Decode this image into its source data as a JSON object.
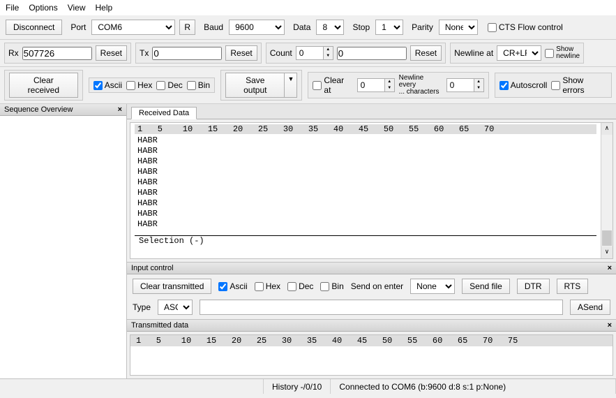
{
  "menu": {
    "file": "File",
    "options": "Options",
    "view": "View",
    "help": "Help"
  },
  "toolbar": {
    "disconnect": "Disconnect",
    "port_label": "Port",
    "port_value": "COM6",
    "r_button": "R",
    "baud_label": "Baud",
    "baud_value": "9600",
    "data_label": "Data",
    "data_value": "8",
    "stop_label": "Stop",
    "stop_value": "1",
    "parity_label": "Parity",
    "parity_value": "None",
    "cts_label": "CTS Flow control"
  },
  "counters": {
    "rx_label": "Rx",
    "rx_value": "507726",
    "tx_label": "Tx",
    "tx_value": "0",
    "reset": "Reset",
    "count_label": "Count",
    "count_spinner": "0",
    "count_field": "0",
    "newline_at_label": "Newline at",
    "newline_at_value": "CR+LF",
    "show_newline": "Show\nnewline"
  },
  "opts": {
    "clear_received": "Clear received",
    "ascii": "Ascii",
    "hex": "Hex",
    "dec": "Dec",
    "bin": "Bin",
    "save_output": "Save output",
    "clear_at": "Clear at",
    "clear_at_value": "0",
    "newline_every": "Newline every\n... characters",
    "newline_every_value": "0",
    "autoscroll": "Autoscroll",
    "show_errors": "Show errors"
  },
  "sidebar": {
    "title": "Sequence Overview"
  },
  "received": {
    "tab": "Received Data",
    "ruler": "1   5    10   15   20   25   30   35   40   45   50   55   60   65   70",
    "lines": [
      "HABR",
      "HABR",
      "HABR",
      "HABR",
      "HABR",
      "HABR",
      "HABR",
      "HABR",
      "HABR"
    ],
    "selection": "Selection (-)"
  },
  "input": {
    "title": "Input control",
    "clear_transmitted": "Clear transmitted",
    "ascii": "Ascii",
    "hex": "Hex",
    "dec": "Dec",
    "bin": "Bin",
    "send_on_enter": "Send on enter",
    "send_on_enter_value": "None",
    "send_file": "Send file",
    "dtr": "DTR",
    "rts": "RTS",
    "type_label": "Type",
    "type_value": "ASC",
    "asend": "ASend"
  },
  "tx": {
    "title": "Transmitted data",
    "ruler": "1   5    10   15   20   25   30   35   40   45   50   55   60   65   70   75"
  },
  "status": {
    "history": "History -/0/10",
    "connected": "Connected to COM6 (b:9600 d:8 s:1 p:None)"
  }
}
